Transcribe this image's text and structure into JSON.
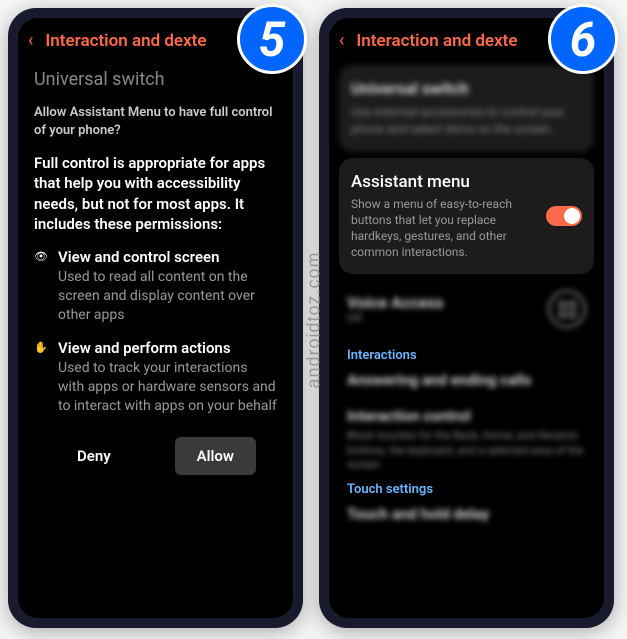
{
  "watermark": "androidtoz.com",
  "phones": {
    "left": {
      "step": "5",
      "header": {
        "title": "Interaction and dexte"
      },
      "subheader": "Universal switch",
      "dialog": {
        "question": "Allow Assistant Menu to have full control of your phone?",
        "intro": "Full control is appropriate for apps that help you with accessibility needs, but not for most apps. It includes these permissions:",
        "perms": [
          {
            "icon": "eye-icon",
            "glyph": "👁",
            "title": "View and control screen",
            "desc": "Used to read all content on the screen and display content over other apps"
          },
          {
            "icon": "hand-icon",
            "glyph": "✋",
            "title": "View and perform actions",
            "desc": "Used to track your interactions with apps or hardware sensors and to interact with apps on your behalf"
          }
        ],
        "deny": "Deny",
        "allow": "Allow"
      }
    },
    "right": {
      "step": "6",
      "header": {
        "title": "Interaction and dexte"
      },
      "blurred_top": {
        "title": "Universal switch",
        "desc": "Use external accessories to control your phone and select items on the screen."
      },
      "assistant": {
        "title": "Assistant menu",
        "desc": "Show a menu of easy-to-reach buttons that let you replace hardkeys, gestures, and other common interactions.",
        "toggle_on": true
      },
      "voice": {
        "title": "Voice Access",
        "sub": "Off"
      },
      "section_interactions": "Interactions",
      "blurred_items": [
        {
          "title": "Answering and ending calls",
          "desc": ""
        },
        {
          "title": "Interaction control",
          "desc": "Block touches for the Back, Home, and Recents buttons, the keyboard, and a selected area of the screen."
        }
      ],
      "section_touch": "Touch settings",
      "blurred_touch": {
        "title": "Touch and hold delay"
      }
    }
  }
}
